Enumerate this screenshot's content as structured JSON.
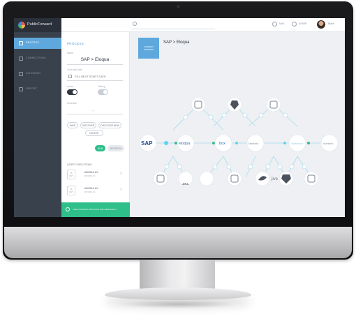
{
  "app": {
    "brand": "PublicForward"
  },
  "topbar": {
    "item1": "MAIL",
    "item2": "ADMIN",
    "user": "Blake"
  },
  "nav": [
    {
      "label": "PROCESS",
      "icon": "process-icon"
    },
    {
      "label": "CONNECTIONS",
      "icon": "link-icon"
    },
    {
      "label": "CALENDAR",
      "icon": "calendar-icon"
    },
    {
      "label": "REPORT",
      "icon": "report-icon"
    }
  ],
  "panel": {
    "title": "PROCESS",
    "name_label": "Name",
    "name_value": "SAP > Eloqua",
    "start_label": "Your start date",
    "start_value": "FILL NEXT START DATE",
    "active_label": "Active",
    "testing_label": "Testing",
    "schedule_label": "Schedule",
    "schedule_value": "+",
    "buttons": {
      "save": "SAVE",
      "discover": "DISCOVER",
      "discover_new": "DISCOVER NEW",
      "delete": "DELETE",
      "run": "RUN",
      "refresh": "REFRESH"
    },
    "executions_label": "LATEST EXECUTIONS",
    "executions": [
      {
        "day": "15",
        "month": "OCT",
        "line1": "6/5/2016 4:0",
        "line2": "6/5/2016 4:1"
      },
      {
        "day": "15",
        "month": "OCT",
        "line1": "6/5/2016 4:0",
        "line2": "6/5/2016 4:1"
      }
    ],
    "notice": "THE CONNECTIONS RAN SUCCESSFULLY"
  },
  "canvas": {
    "badge": "CURRENT PROCESS",
    "title": "SAP > Eloqua",
    "nodes": [
      "SAP",
      "eloqua",
      "box",
      "Marketo",
      "Salesforce",
      "marketo",
      "JIRA",
      "jive"
    ]
  },
  "colors": {
    "accent": "#5fa8dd",
    "success": "#2fbf8a",
    "nav_bg": "#39414d"
  }
}
